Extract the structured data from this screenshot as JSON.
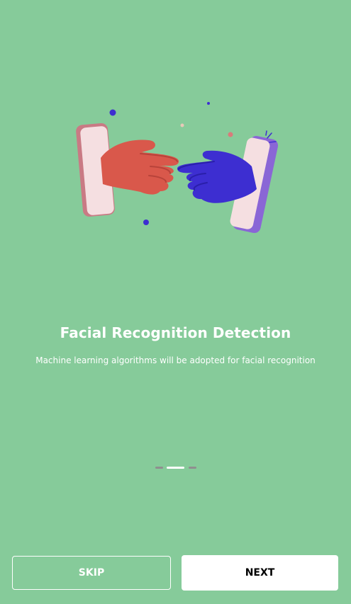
{
  "onboarding": {
    "title": "Facial Recognition Detection",
    "description": "Machine learning algorithms will be adopted for facial recognition",
    "illustration": "hands-reaching-from-phones",
    "pagination": {
      "total": 3,
      "active": 2
    }
  },
  "actions": {
    "skip_label": "SKIP",
    "next_label": "NEXT"
  },
  "colors": {
    "background": "#86cb9a",
    "indicator_active": "#ffffff",
    "indicator_inactive": "#8f8f8f",
    "hand_left": "#d9584b",
    "hand_right": "#3d2ed1",
    "phone_left": "#c97a84",
    "phone_right": "#8a66d6",
    "phone_screen": "#f5dfe1"
  }
}
